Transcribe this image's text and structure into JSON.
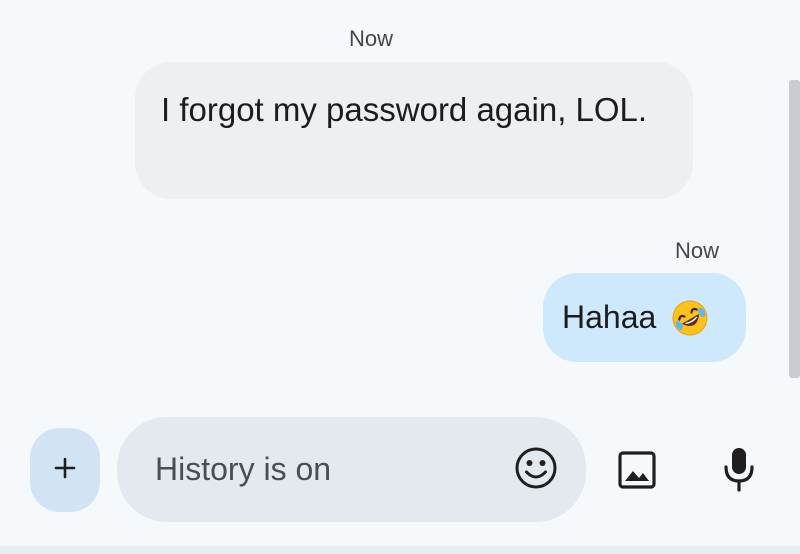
{
  "conversation": {
    "messages": [
      {
        "timestamp": "Now",
        "direction": "incoming",
        "text": "I forgot my password again, LOL."
      },
      {
        "timestamp": "Now",
        "direction": "outgoing",
        "text": "Hahaa",
        "emoji": "rolling-on-the-floor-laughing"
      }
    ]
  },
  "composer": {
    "add_icon": "plus-icon",
    "placeholder": "History is on",
    "emoji_icon": "smiley-icon",
    "image_icon": "image-icon",
    "mic_icon": "mic-icon"
  },
  "colors": {
    "background": "#f5f9fc",
    "incoming_bubble": "#eeeff2",
    "outgoing_bubble": "#cde9fb",
    "compose_field": "#e4e9f0",
    "add_button": "#d2e4f4",
    "icon": "#1f1f1f"
  }
}
